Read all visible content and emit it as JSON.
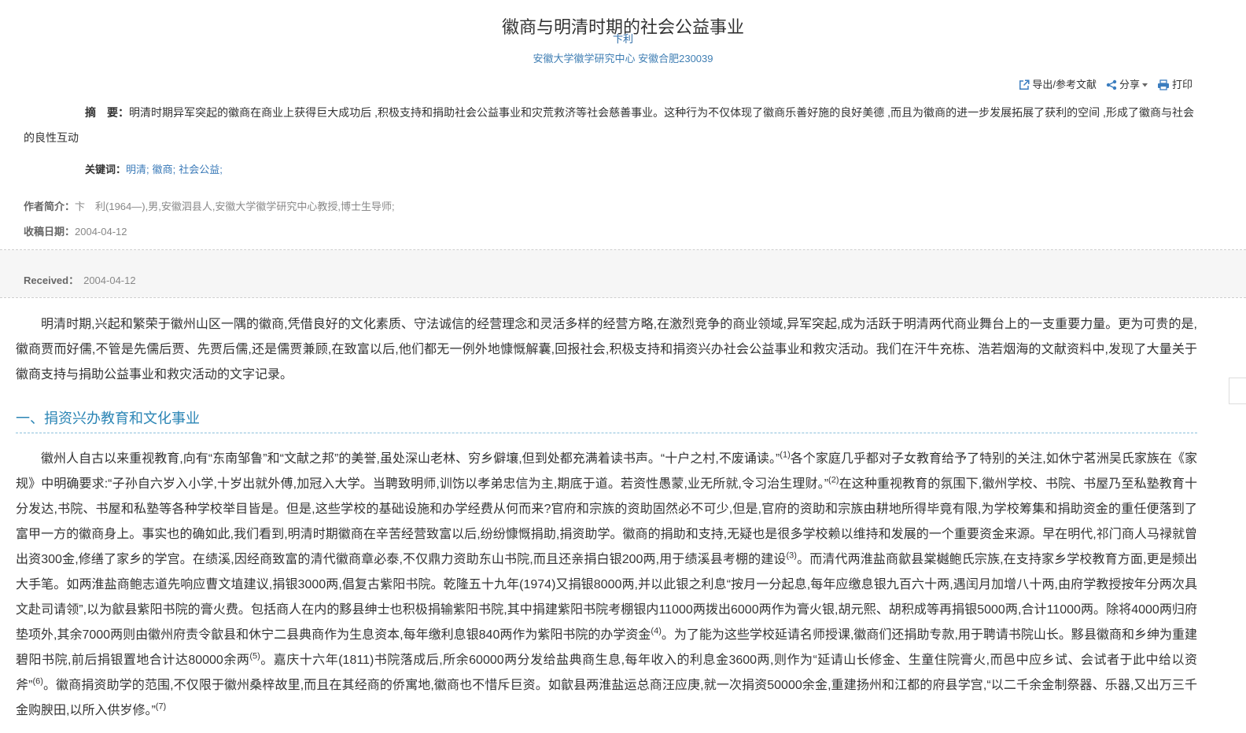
{
  "article": {
    "title": "徽商与明清时期的社会公益事业",
    "author": "卞利",
    "affiliation": "安徽大学徽学研究中心 安徽合肥230039"
  },
  "toolbar": {
    "export_label": "导出/参考文献",
    "share_label": "分享",
    "print_label": "打印"
  },
  "abstract": {
    "label": "摘　要：",
    "text": "明清时期异军突起的徽商在商业上获得巨大成功后 ,积极支持和捐助社会公益事业和灾荒救济等社会慈善事业。这种行为不仅体现了徽商乐善好施的良好美德 ,而且为徽商的进一步发展拓展了获利的空间 ,形成了徽商与社会的良性互动"
  },
  "keywords": {
    "label": "关键词：",
    "items": [
      "明清;",
      "徽商;",
      "社会公益;"
    ]
  },
  "author_intro": {
    "label": "作者简介：",
    "text": "卞　利(1964—),男,安徽泗县人,安徽大学徽学研究中心教授,博士生导师;"
  },
  "received_cn": {
    "label": "收稿日期：",
    "date": "2004-04-12"
  },
  "received_en": {
    "label": "Received：",
    "date": "2004-04-12"
  },
  "body": {
    "intro_paragraph": "明清时期,兴起和繁荣于徽州山区一隅的徽商,凭借良好的文化素质、守法诚信的经营理念和灵活多样的经营方略,在激烈竞争的商业领域,异军突起,成为活跃于明清两代商业舞台上的一支重要力量。更为可贵的是,徽商贾而好儒,不管是先儒后贾、先贾后儒,还是儒贾兼顾,在致富以后,他们都无一例外地慷慨解囊,回报社会,积极支持和捐资兴办社会公益事业和救灾活动。我们在汗牛充栋、浩若烟海的文献资料中,发现了大量关于徽商支持与捐助公益事业和救灾活动的文字记录。",
    "section_1": {
      "heading": "一、捐资兴办教育和文化事业",
      "paragraph": [
        {
          "text": "徽州人自古以来重视教育,向有“东南邹鲁”和“文献之邦”的美誉,虽处深山老林、穷乡僻壤,但到处都充满着读书声。“十户之村,不废诵读。”"
        },
        {
          "note": "(1)"
        },
        {
          "text": "各个家庭几乎都对子女教育给予了特别的关注,如休宁茗洲吴氏家族在《家规》中明确要求:“子孙自六岁入小学,十岁出就外傅,加冠入大学。当聘致明师,训饬以孝弟忠信为主,期底于道。若资性愚蒙,业无所就,令习治生理财。”"
        },
        {
          "note": "(2)"
        },
        {
          "text": "在这种重视教育的氛围下,徽州学校、书院、书屋乃至私塾教育十分发达,书院、书屋和私塾等各种学校举目皆是。但是,这些学校的基础设施和办学经费从何而来?官府和宗族的资助固然必不可少,但是,官府的资助和宗族由耕地所得毕竟有限,为学校筹集和捐助资金的重任便落到了富甲一方的徽商身上。事实也的确如此,我们看到,明清时期徽商在辛苦经营致富以后,纷纷慷慨捐助,捐资助学。徽商的捐助和支持,无疑也是很多学校赖以维持和发展的一个重要资金来源。早在明代,祁门商人马禄就曾出资300金,修缮了家乡的学宫。在绩溪,因经商致富的清代徽商章必泰,不仅鼎力资助东山书院,而且还亲捐白银200两,用于绩溪县考棚的建设"
        },
        {
          "note": "(3)"
        },
        {
          "text": "。而清代两淮盐商歙县棠樾鲍氏宗族,在支持家乡学校教育方面,更是频出大手笔。如两淮盐商鲍志道先响应曹文埴建议,捐银3000两,倡复古紫阳书院。乾隆五十九年(1974)又捐银8000两,并以此银之利息“按月一分起息,每年应缴息银九百六十两,遇闰月加增八十两,由府学教授按年分两次具文赴司请领”,以为歙县紫阳书院的膏火费。包括商人在内的黟县绅士也积极捐输紫阳书院,其中捐建紫阳书院考棚银内11000两拨出6000两作为膏火银,胡元熙、胡积成等再捐银5000两,合计11000两。除将4000两归府垫项外,其余7000两则由徽州府责令歙县和休宁二县典商作为生息资本,每年缴利息银840两作为紫阳书院的办学资金"
        },
        {
          "note": "(4)"
        },
        {
          "text": "。为了能为这些学校延请名师授课,徽商们还捐助专款,用于聘请书院山长。黟县徽商和乡绅为重建碧阳书院,前后捐银置地合计达80000余两"
        },
        {
          "note": "(5)"
        },
        {
          "text": "。嘉庆十六年(1811)书院落成后,所余60000两分发给盐典商生息,每年收入的利息金3600两,则作为“延请山长修金、生童住院膏火,而邑中应乡试、会试者于此中给以资斧”"
        },
        {
          "note": "(6)"
        },
        {
          "text": "。徽商捐资助学的范围,不仅限于徽州桑梓故里,而且在其经商的侨寓地,徽商也不惜斥巨资。如歙县两淮盐运总商汪应庚,就一次捐资50000余金,重建扬州和江都的府县学宫,“以二千余金制祭器、乐器,又出万三千金购腴田,以所入供岁修。”"
        },
        {
          "note": "(7)"
        }
      ]
    }
  },
  "colors": {
    "link": "#2f6ea8",
    "keyword_link": "#3a7ab8",
    "toolbar_icon": "#3b7dbf",
    "section_heading": "#2b85b5",
    "body_text": "#333333",
    "meta_gray": "#888888",
    "band_background": "#f6f6f6"
  },
  "icons": {
    "export": "export-icon",
    "share": "share-icon",
    "share_menu": "caret-down-icon",
    "print": "printer-icon"
  }
}
